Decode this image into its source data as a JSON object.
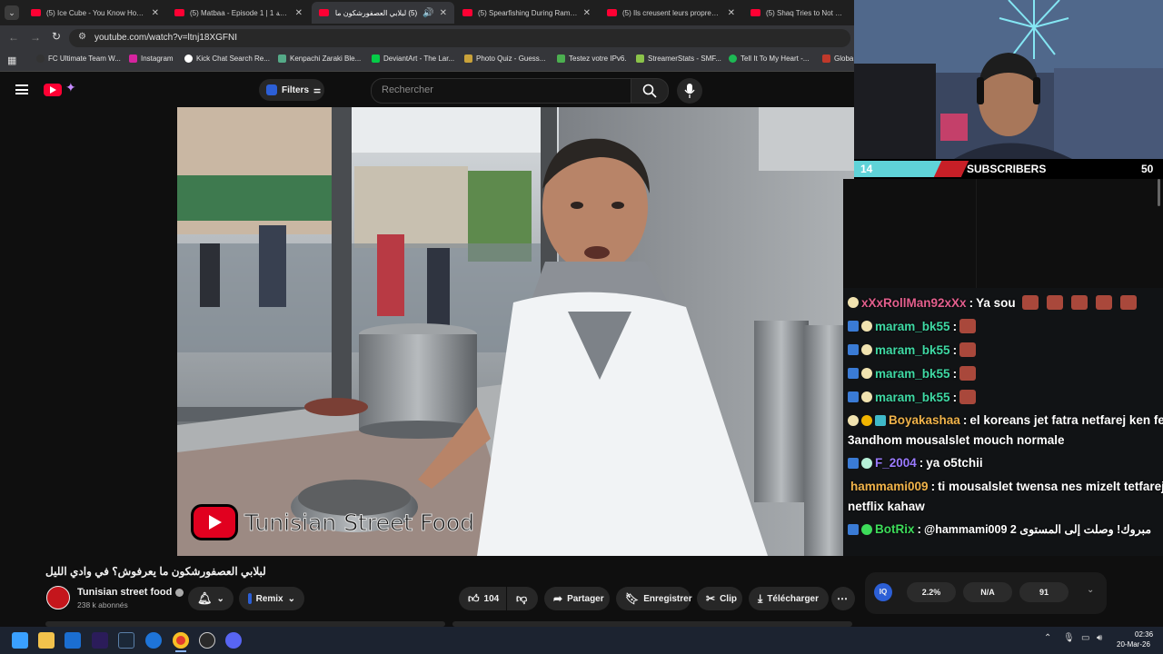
{
  "browser": {
    "tabs": [
      {
        "title": "(5) Ice Cube - You Know How W",
        "active": false
      },
      {
        "title": "(5) Matbaa - Episode 1 | 1 حلقة",
        "active": false
      },
      {
        "title": "(5) لبلابي العصفورشكون ما",
        "active": true
      },
      {
        "title": "(5) Spearfishing During Ramad",
        "active": false
      },
      {
        "title": "(5) Ils creusent leurs propres to",
        "active": false
      },
      {
        "title": "(5) Shaq Tries to Not Make a",
        "active": false
      }
    ],
    "url": "youtube.com/watch?v=ltnj18XGFNI",
    "bookmarks": [
      "FC Ultimate Team W...",
      "Instagram",
      "Kick Chat Search Re...",
      "Kenpachi Zaraki Ble...",
      "DeviantArt - The Lar...",
      "Photo Quiz - Guess...",
      "Testez votre IPv6.",
      "StreamerStats - SMF...",
      "Tell It To My Heart -...",
      "Globa"
    ]
  },
  "youtube": {
    "filters_label": "Filters",
    "search_placeholder": "Rechercher",
    "video_watermark": "Tunisian Street Food",
    "video_title": "لبلابي العصفورشكون ما يعرفوش؟ في وادي الليل",
    "channel_name": "Tunisian street food",
    "subscribers": "238 k abonnés",
    "remix_label": "Remix",
    "likes": "104",
    "share_label": "Partager",
    "save_label": "Enregistrer",
    "clip_label": "Clip",
    "download_label": "Télécharger",
    "iq_stats": [
      "2.2%",
      "N/A",
      "91"
    ]
  },
  "stream": {
    "sub_count_left": "14",
    "sub_label": "SUBSCRIBERS",
    "sub_goal": "50",
    "chat": [
      {
        "user": "xXxRollMan92xXx",
        "color": "#e35f8d",
        "message": "Ya sou"
      },
      {
        "user": "maram_bk55",
        "color": "#3fd9a4",
        "message": ""
      },
      {
        "user": "maram_bk55",
        "color": "#3fd9a4",
        "message": ""
      },
      {
        "user": "maram_bk55",
        "color": "#3fd9a4",
        "message": ""
      },
      {
        "user": "maram_bk55",
        "color": "#3fd9a4",
        "message": ""
      },
      {
        "user": "Boyakashaa",
        "color": "#f0b34a",
        "message": "el koreans jet fatra netfarej ken fe"
      },
      {
        "user": "",
        "color": "#ffffff",
        "message": "3andhom mousalslet mouch normale"
      },
      {
        "user": "F_2004",
        "color": "#9b7bff",
        "message": "ya o5tchii"
      },
      {
        "user": "hammami009",
        "color": "#f0b34a",
        "message": "ti mousalslet twensa nes mizelt tetfarej"
      },
      {
        "user": "",
        "color": "#ffffff",
        "message": "netflix kahaw"
      },
      {
        "user": "BotRix",
        "color": "#3ddc5a",
        "message": "@hammami009 مبروك! وصلت إلى المستوى 2"
      }
    ]
  },
  "taskbar": {
    "time": "02:36",
    "date": "20-Mar-26"
  }
}
